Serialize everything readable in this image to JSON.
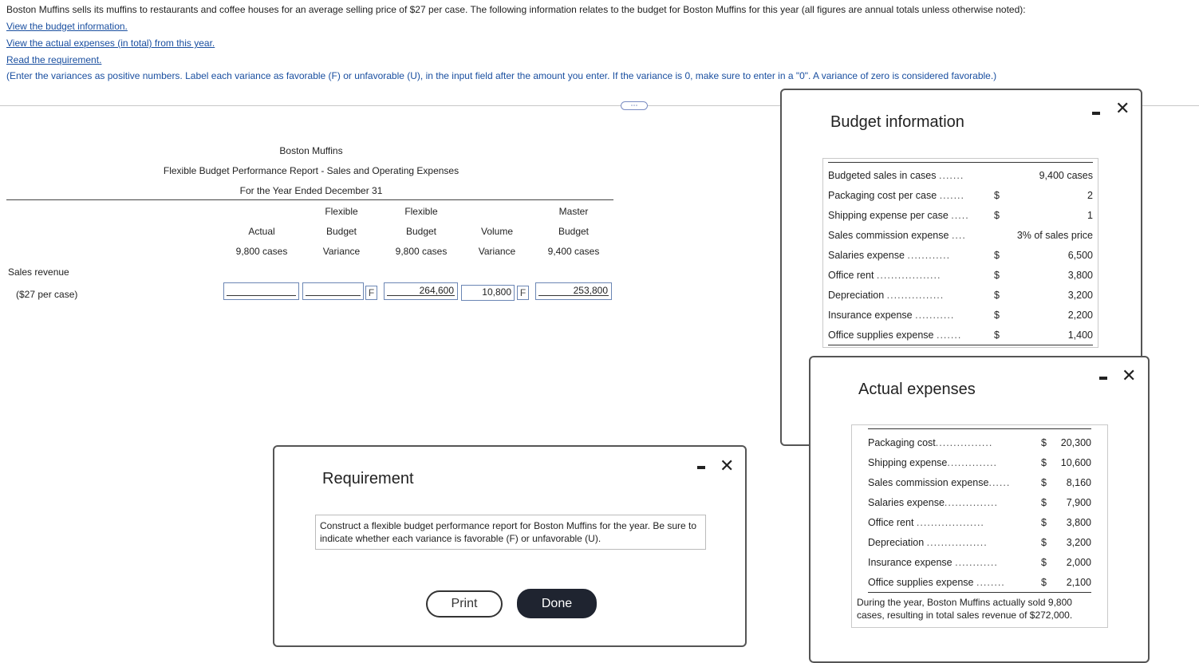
{
  "problem": {
    "intro": "Boston Muffins sells its muffins to restaurants and coffee houses for an average selling price of $27 per case. The following information relates to the budget for Boston Muffins for this year (all figures are annual totals unless otherwise noted):",
    "link_budget": "View the budget information.",
    "link_actual": "View the actual expenses (in total) from this year.",
    "link_requirement": "Read the requirement.",
    "instructions": "(Enter the variances as positive numbers. Label each variance as favorable (F) or unfavorable (U), in the input field after the amount you enter. If the variance is 0, make sure to enter in a \"0\". A variance of zero is considered favorable.)",
    "more_button": "⋯"
  },
  "report": {
    "company": "Boston Muffins",
    "title": "Flexible Budget Performance Report - Sales and Operating Expenses",
    "period": "For the Year Ended December 31",
    "columns": [
      {
        "l1": "",
        "l2": "Actual",
        "l3": "9,800 cases"
      },
      {
        "l1": "Flexible",
        "l2": "Budget",
        "l3": "Variance"
      },
      {
        "l1": "Flexible",
        "l2": "Budget",
        "l3": "9,800 cases"
      },
      {
        "l1": "",
        "l2": "Volume",
        "l3": "Variance"
      },
      {
        "l1": "Master",
        "l2": "Budget",
        "l3": "9,400 cases"
      }
    ],
    "row_label": "Sales revenue",
    "row_sublabel": "($27 per case)",
    "cells": {
      "actual": "",
      "flex_var": "",
      "flex_var_label": "F",
      "flex_budget": "264,600",
      "volume_var": "10,800",
      "volume_var_label": "F",
      "master": "253,800"
    }
  },
  "budget_dialog": {
    "title": "Budget information",
    "rows": [
      {
        "label": "Budgeted sales in cases",
        "dots": ".......",
        "cur": "",
        "value": "9,400 cases"
      },
      {
        "label": "Packaging cost per case",
        "dots": ".......",
        "cur": "$",
        "value": "2"
      },
      {
        "label": "Shipping expense per case",
        "dots": ".....",
        "cur": "$",
        "value": "1"
      },
      {
        "label": "Sales commission expense",
        "dots": "....",
        "cur": "",
        "value": "3% of sales price"
      },
      {
        "label": "Salaries expense",
        "dots": "............",
        "cur": "$",
        "value": "6,500"
      },
      {
        "label": "Office rent",
        "dots": "..................",
        "cur": "$",
        "value": "3,800"
      },
      {
        "label": "Depreciation",
        "dots": "................",
        "cur": "$",
        "value": "3,200"
      },
      {
        "label": "Insurance expense",
        "dots": "...........",
        "cur": "$",
        "value": "2,200"
      },
      {
        "label": "Office supplies expense",
        "dots": ".......",
        "cur": "$",
        "value": "1,400"
      }
    ]
  },
  "actual_dialog": {
    "title": "Actual expenses",
    "rows": [
      {
        "label": "Packaging cost",
        "dots": "................",
        "cur": "$",
        "value": "20,300"
      },
      {
        "label": "Shipping expense",
        "dots": "..............",
        "cur": "$",
        "value": "10,600"
      },
      {
        "label": "Sales commission expense",
        "dots": "......",
        "cur": "$",
        "value": "8,160"
      },
      {
        "label": "Salaries expense",
        "dots": "...............",
        "cur": "$",
        "value": "7,900"
      },
      {
        "label": "Office rent",
        "dots": "...................",
        "cur": "$",
        "value": "3,800"
      },
      {
        "label": "Depreciation",
        "dots": ".................",
        "cur": "$",
        "value": "3,200"
      },
      {
        "label": "Insurance expense",
        "dots": "............",
        "cur": "$",
        "value": "2,000"
      },
      {
        "label": "Office supplies expense",
        "dots": "........",
        "cur": "$",
        "value": "2,100"
      }
    ],
    "note": "During the year, Boston Muffins actually sold 9,800 cases, resulting in total sales revenue of $272,000."
  },
  "requirement_dialog": {
    "title": "Requirement",
    "text": "Construct a flexible budget performance report for Boston Muffins for the year. Be sure to indicate whether each variance is favorable (F) or unfavorable (U).",
    "print_label": "Print",
    "done_label": "Done"
  }
}
